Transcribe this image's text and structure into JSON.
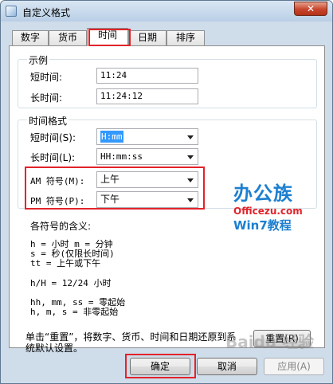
{
  "window": {
    "title": "自定义格式",
    "close_glyph": "✕"
  },
  "tabs": [
    {
      "label": "数字"
    },
    {
      "label": "货币"
    },
    {
      "label": "时间"
    },
    {
      "label": "日期"
    },
    {
      "label": "排序"
    }
  ],
  "sample": {
    "group_label": "示例",
    "short_label": "短时间:",
    "short_value": "11:24",
    "long_label": "长时间:",
    "long_value": "11:24:12"
  },
  "time_formats": {
    "group_label": "时间格式",
    "short_label": "短时间(S):",
    "short_value": "H:mm",
    "long_label": "长时间(L):",
    "long_value": "HH:mm:ss",
    "am_label": "AM 符号(M):",
    "am_value": "上午",
    "pm_label": "PM 符号(P):",
    "pm_value": "下午"
  },
  "notation": {
    "heading": "各符号的含义:",
    "lines": [
      "h = 小时   m = 分钟",
      "s = 秒(仅限长时间)",
      "tt = 上午或下午",
      "h/H = 12/24 小时",
      "hh, mm, ss = 零起始",
      "h, m, s = 非零起始"
    ]
  },
  "reset": {
    "text_line1": "单击“重置”，将数字、货币、时间和日期还原到系",
    "text_line2": "统默认设置。",
    "button": "重置(R)"
  },
  "footer": {
    "ok": "确定",
    "cancel": "取消",
    "apply": "应用(A)"
  },
  "watermark": {
    "brand": "办公族",
    "site": "Officezu.com",
    "tagline": "Win7教程",
    "baidu": "Baidu 经验"
  },
  "colors": {
    "highlight": "#e2232a",
    "brand_blue": "#1d7fd0",
    "brand_red": "#e2232a"
  }
}
